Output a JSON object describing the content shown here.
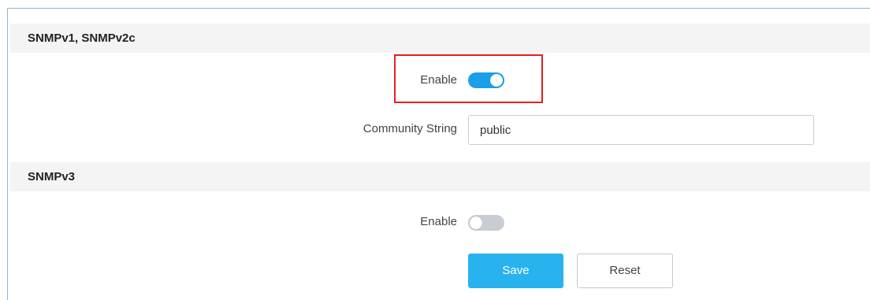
{
  "snmp_v1_v2c": {
    "title": "SNMPv1, SNMPv2c",
    "enable_label": "Enable",
    "enable_state": "on",
    "community_label": "Community String",
    "community_value": "public"
  },
  "snmp_v3": {
    "title": "SNMPv3",
    "enable_label": "Enable",
    "enable_state": "off"
  },
  "actions": {
    "save_label": "Save",
    "reset_label": "Reset"
  },
  "colors": {
    "toggle_on": "#1a9fe8",
    "toggle_off": "#c8ccd3",
    "save_button": "#29b3ee",
    "highlight": "#e02020"
  }
}
